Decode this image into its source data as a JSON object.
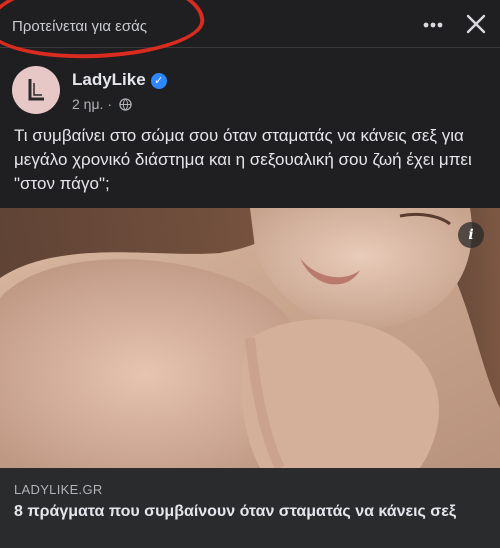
{
  "header": {
    "suggested_label": "Προτείνεται για εσάς",
    "more_icon": "more-horizontal-icon",
    "close_icon": "close-icon"
  },
  "author": {
    "name": "LadyLike",
    "verified": true,
    "time": "2 ημ.",
    "separator": "·",
    "audience_icon": "globe-icon"
  },
  "post": {
    "text": "Τι συμβαίνει στο σώμα σου όταν σταματάς να κάνεις σεξ για μεγάλο χρονικό διάστημα και η σεξουαλική σου ζωή έχει μπει \"στον πάγο\";"
  },
  "link_preview": {
    "domain": "LADYLIKE.GR",
    "title": "8 πράγματα που συμβαίνουν όταν σταματάς να κάνεις σεξ",
    "info_icon": "info-icon"
  },
  "colors": {
    "background": "#1f1f21",
    "card": "#2a2b2d",
    "annotation_circle": "#d92b1f",
    "verified_badge": "#2d88ff"
  }
}
